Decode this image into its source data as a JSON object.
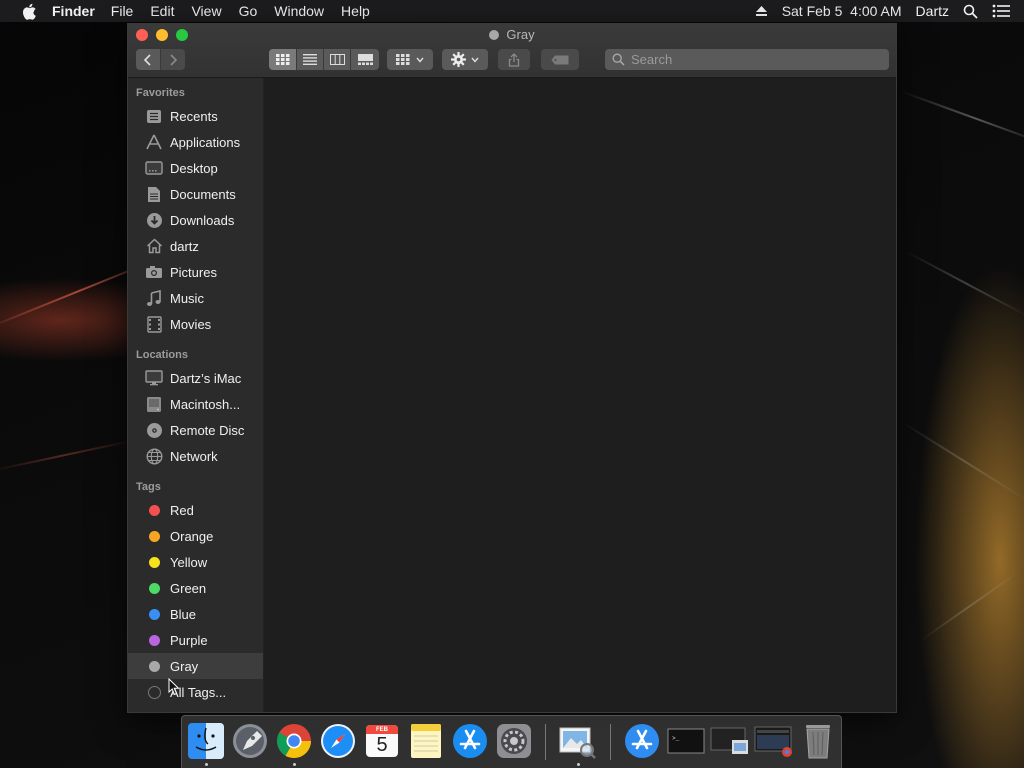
{
  "menubar": {
    "app_name": "Finder",
    "menus": [
      "File",
      "Edit",
      "View",
      "Go",
      "Window",
      "Help"
    ],
    "datetime": "Sat Feb 5  4:00 AM",
    "user": "Dartz"
  },
  "window": {
    "title": "Gray",
    "search_placeholder": "Search"
  },
  "sidebar": {
    "favorites_title": "Favorites",
    "favorites": [
      {
        "label": "Recents",
        "icon": "recents-icon"
      },
      {
        "label": "Applications",
        "icon": "applications-icon"
      },
      {
        "label": "Desktop",
        "icon": "desktop-icon"
      },
      {
        "label": "Documents",
        "icon": "documents-icon"
      },
      {
        "label": "Downloads",
        "icon": "downloads-icon"
      },
      {
        "label": "dartz",
        "icon": "home-icon"
      },
      {
        "label": "Pictures",
        "icon": "pictures-icon"
      },
      {
        "label": "Music",
        "icon": "music-icon"
      },
      {
        "label": "Movies",
        "icon": "movies-icon"
      }
    ],
    "locations_title": "Locations",
    "locations": [
      {
        "label": "Dartz’s iMac",
        "icon": "imac-icon"
      },
      {
        "label": "Macintosh...",
        "icon": "hard-drive-icon"
      },
      {
        "label": "Remote Disc",
        "icon": "disc-icon"
      },
      {
        "label": "Network",
        "icon": "network-icon"
      }
    ],
    "tags_title": "Tags",
    "tags": [
      {
        "label": "Red",
        "color": "#f4504f"
      },
      {
        "label": "Orange",
        "color": "#f5a623"
      },
      {
        "label": "Yellow",
        "color": "#f7e01c"
      },
      {
        "label": "Green",
        "color": "#4cd964"
      },
      {
        "label": "Blue",
        "color": "#3b8ff3"
      },
      {
        "label": "Purple",
        "color": "#b865e0"
      },
      {
        "label": "Gray",
        "color": "#a8a8a8"
      },
      {
        "label": "All Tags...",
        "color": "transparent"
      }
    ],
    "selected": "Gray"
  },
  "dock": {
    "items": [
      "finder-icon",
      "launchpad-icon",
      "chrome-icon",
      "safari-icon",
      "calendar-icon",
      "notes-icon",
      "app-store-icon",
      "system-preferences-icon",
      "preview-icon",
      "downloads-stack-icon",
      "terminal-window-icon",
      "screenshot-window-icon",
      "chrome-window-icon",
      "trash-icon"
    ],
    "calendar_month": "FEB",
    "calendar_day": "5"
  },
  "colors": {
    "accent_selected_row": "#3d3d3d",
    "window_bg": "#1e1e1e",
    "sidebar_bg": "#2b2b2b"
  }
}
